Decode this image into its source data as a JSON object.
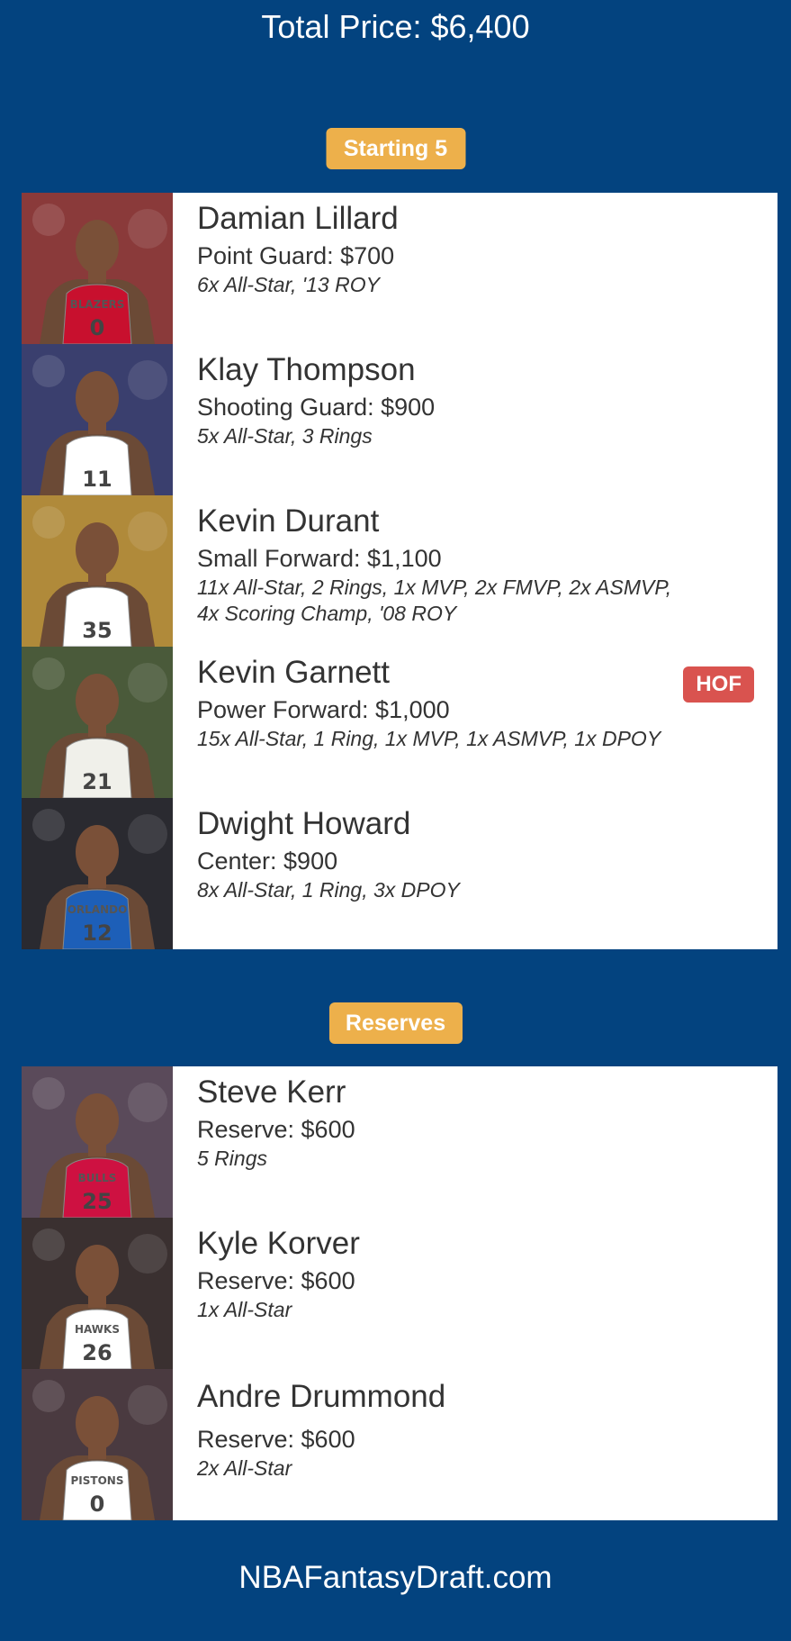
{
  "total_price": "Total Price: $6,400",
  "sections": {
    "starting_label": "Starting 5",
    "reserves_label": "Reserves"
  },
  "starters": [
    {
      "name": "Damian Lillard",
      "position": "Point Guard: $700",
      "accolades": "6x All-Star, '13 ROY",
      "jersey_color": "#c8102e",
      "jersey_number": "0",
      "jersey_text": "BLAZERS",
      "bg": "#8a3a3a"
    },
    {
      "name": "Klay Thompson",
      "position": "Shooting Guard: $900",
      "accolades": "5x All-Star, 3 Rings",
      "jersey_color": "#ffffff",
      "jersey_number": "11",
      "jersey_text": "",
      "bg": "#3a3f6e"
    },
    {
      "name": "Kevin Durant",
      "position": "Small Forward: $1,100",
      "accolades": "11x All-Star, 2 Rings, 1x MVP, 2x FMVP, 2x ASMVP,\n4x Scoring Champ, '08 ROY",
      "jersey_color": "#ffffff",
      "jersey_number": "35",
      "jersey_text": "",
      "bg": "#b08a3a"
    },
    {
      "name": "Kevin Garnett",
      "position": "Power Forward: $1,000",
      "accolades": "15x All-Star, 1 Ring, 1x MVP, 1x ASMVP, 1x DPOY",
      "hof": "HOF",
      "jersey_color": "#f0f0ea",
      "jersey_number": "21",
      "jersey_text": "",
      "bg": "#4a5a3a"
    },
    {
      "name": "Dwight Howard",
      "position": "Center: $900",
      "accolades": "8x All-Star, 1 Ring, 3x DPOY",
      "jersey_color": "#1d5fb8",
      "jersey_number": "12",
      "jersey_text": "ORLANDO",
      "bg": "#2a2a30"
    }
  ],
  "reserves": [
    {
      "name": "Steve Kerr",
      "position": "Reserve: $600",
      "accolades": "5 Rings",
      "jersey_color": "#ce1141",
      "jersey_number": "25",
      "jersey_text": "BULLS",
      "bg": "#5a4a5a"
    },
    {
      "name": "Kyle Korver",
      "position": "Reserve: $600",
      "accolades": "1x All-Star",
      "jersey_color": "#ffffff",
      "jersey_number": "26",
      "jersey_text": "HAWKS",
      "bg": "#3a3030"
    },
    {
      "name": "Andre Drummond",
      "position": "Reserve: $600",
      "accolades": "2x All-Star",
      "jersey_color": "#ffffff",
      "jersey_number": "0",
      "jersey_text": "PISTONS",
      "bg": "#4a3a40"
    }
  ],
  "footer": "NBAFantasyDraft.com",
  "colors": {
    "background": "#03437f",
    "badge": "#edb04b",
    "hof_badge": "#d9534f"
  }
}
